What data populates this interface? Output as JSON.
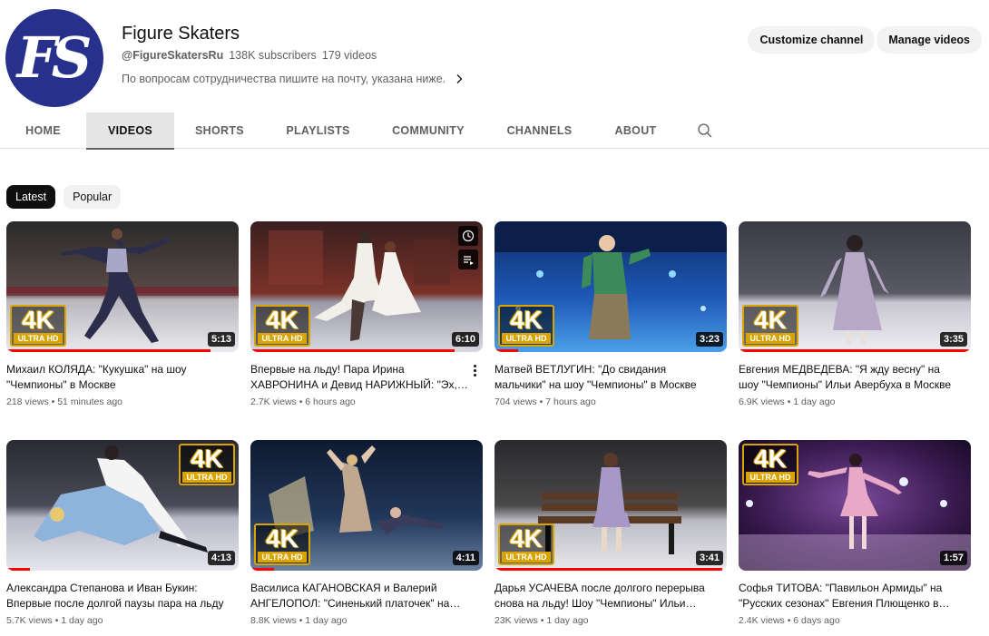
{
  "channel": {
    "avatar_text": "FS",
    "name": "Figure Skaters",
    "handle": "@FigureSkatersRu",
    "subscribers": "138K subscribers",
    "video_count": "179 videos",
    "description": "По вопросам сотрудничества пишите на почту, указана ниже."
  },
  "buttons": {
    "customize": "Customize channel",
    "manage": "Manage videos"
  },
  "tabs": [
    {
      "label": "HOME"
    },
    {
      "label": "VIDEOS",
      "active": true
    },
    {
      "label": "SHORTS"
    },
    {
      "label": "PLAYLISTS"
    },
    {
      "label": "COMMUNITY"
    },
    {
      "label": "CHANNELS"
    },
    {
      "label": "ABOUT"
    }
  ],
  "chips": [
    {
      "label": "Latest",
      "selected": true
    },
    {
      "label": "Popular",
      "selected": false
    }
  ],
  "badge": {
    "k": "4K",
    "uhd": "ULTRA HD"
  },
  "videos": [
    {
      "title": "Михаил КОЛЯДА: \"Кукушка\" на шоу \"Чемпионы\" в Москве",
      "views": "218 views",
      "age": "51 minutes ago",
      "duration": "5:13",
      "watched": 0.88
    },
    {
      "title": "Впервые на льду! Пара Ирина ХАВРОНИНА и Девид НАРИЖНЫЙ: \"Эх, Андрюша\" на шоу \"Чемпионы\" в Москве",
      "views": "2.7K views",
      "age": "6 hours ago",
      "duration": "6:10",
      "watched": 0.88
    },
    {
      "title": "Матвей ВЕТЛУГИН: \"До свидания мальчики\" на шоу \"Чемпионы\" в Москве",
      "views": "704 views",
      "age": "7 hours ago",
      "duration": "3:23",
      "watched": 0.1
    },
    {
      "title": "Евгения МЕДВЕДЕВА: \"Я жду весну\" на шоу \"Чемпионы\" Ильи Авербуха в Москве",
      "views": "6.9K views",
      "age": "1 day ago",
      "duration": "3:35",
      "watched": 1.0
    },
    {
      "title": "Александра Степанова и Иван Букин: Впервые после долгой паузы пара на льду",
      "views": "5.7K views",
      "age": "1 day ago",
      "duration": "4:13",
      "watched": 0.1
    },
    {
      "title": "Василиса КАГАНОВСКАЯ и Валерий АНГЕЛОПОЛ: \"Синенький платочек\" на шоу",
      "views": "8.8K views",
      "age": "1 day ago",
      "duration": "4:11",
      "watched": 0.1
    },
    {
      "title": "Дарья УСАЧЕВА после долгого перерыва снова на льду! Шоу \"Чемпионы\" Ильи Авербуха",
      "views": "23K views",
      "age": "1 day ago",
      "duration": "3:41",
      "watched": 0.98
    },
    {
      "title": "Софья ТИТОВА: \"Павильон Армиды\" на \"Русских сезонах\" Евгения Плющенко в Москве",
      "views": "2.4K views",
      "age": "6 days ago",
      "duration": "1:57",
      "watched": 0
    }
  ],
  "colors": {
    "avatar_bg": "#27318b",
    "badge_gold": "#d9a400",
    "progress_red": "#ff0000"
  }
}
